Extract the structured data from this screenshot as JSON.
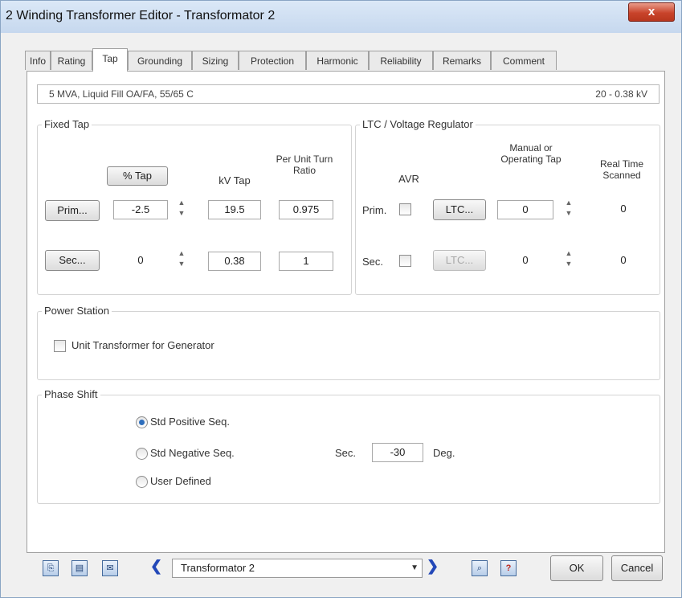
{
  "window": {
    "title": "2 Winding Transformer Editor - Transformator 2",
    "close_label": "x"
  },
  "tabs": [
    "Info",
    "Rating",
    "Tap",
    "Grounding",
    "Sizing",
    "Protection",
    "Harmonic",
    "Reliability",
    "Remarks",
    "Comment"
  ],
  "active_tab": "Tap",
  "summary": {
    "rating": "5 MVA, Liquid Fill OA/FA, 55/65 C",
    "voltage": "20 - 0.38 kV"
  },
  "fixed_tap": {
    "group_label": "Fixed Tap",
    "pct_tap_button": "% Tap",
    "kv_tap_header": "kV Tap",
    "per_unit_header": "Per Unit Turn Ratio",
    "prim_button": "Prim...",
    "sec_button": "Sec...",
    "prim_pct_tap": "-2.5",
    "prim_kv_tap": "19.5",
    "prim_turn_ratio": "0.975",
    "sec_pct_tap": "0",
    "sec_kv_tap": "0.38",
    "sec_turn_ratio": "1"
  },
  "ltc": {
    "group_label": "LTC / Voltage Regulator",
    "avr_header": "AVR",
    "manual_header": "Manual or Operating Tap",
    "realtime_header": "Real Time Scanned",
    "prim_label": "Prim.",
    "sec_label": "Sec.",
    "ltc_button": "LTC...",
    "prim_manual_tap": "0",
    "prim_realtime": "0",
    "sec_manual_tap": "0",
    "sec_realtime": "0"
  },
  "power_station": {
    "group_label": "Power Station",
    "unit_transformer_label": "Unit Transformer for Generator"
  },
  "phase_shift": {
    "group_label": "Phase Shift",
    "options": [
      "Std Positive Seq.",
      "Std Negative Seq.",
      "User Defined"
    ],
    "selected": "Std Positive Seq.",
    "sec_label": "Sec.",
    "sec_value": "-30",
    "deg_label": "Deg."
  },
  "footer": {
    "element_name": "Transformator 2",
    "ok_label": "OK",
    "cancel_label": "Cancel"
  },
  "icons": [
    "copy-icon",
    "paste-icon",
    "report-icon",
    "prev-arrow-icon",
    "next-arrow-icon",
    "find-icon",
    "help-icon"
  ]
}
